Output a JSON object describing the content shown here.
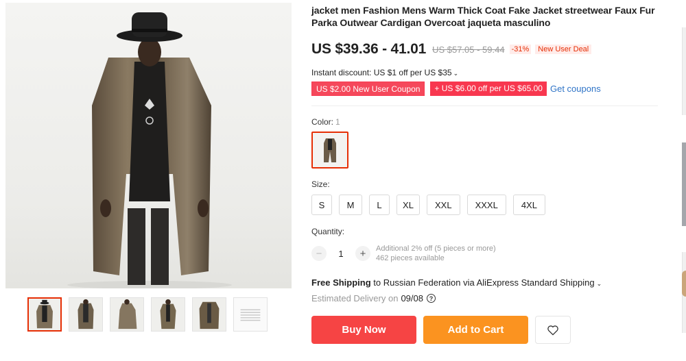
{
  "gallery": {
    "main_image": "fur-coat-model-photo",
    "thumbnails": [
      {
        "name": "thumb-1",
        "active": true
      },
      {
        "name": "thumb-2",
        "active": false
      },
      {
        "name": "thumb-3",
        "active": false
      },
      {
        "name": "thumb-4",
        "active": false
      },
      {
        "name": "thumb-5",
        "active": false
      },
      {
        "name": "thumb-6",
        "active": false
      }
    ]
  },
  "product": {
    "title": "jacket men Fashion Mens Warm Thick Coat Fake Jacket streetwear Faux Fur Parka Outwear Cardigan Overcoat jaqueta masculino",
    "price": "US $39.36 - 41.01",
    "original_price": "US $57.05 - 59.44",
    "discount": "-31%",
    "deal_badge": "New User Deal",
    "instant_discount": "Instant discount: US $1 off per US $35",
    "coupons": [
      "US $2.00 New User Coupon",
      "+ US $6.00 off per US $65.00"
    ],
    "get_coupons": "Get coupons"
  },
  "options": {
    "color_label": "Color:",
    "color_count": "1",
    "size_label": "Size:",
    "sizes": [
      "S",
      "M",
      "L",
      "XL",
      "XXL",
      "XXXL",
      "4XL"
    ]
  },
  "quantity": {
    "label": "Quantity:",
    "value": "1",
    "note_line1": "Additional 2% off (5 pieces or more)",
    "note_line2": "462 pieces available"
  },
  "shipping": {
    "free": "Free Shipping",
    "rest": " to Russian Federation via AliExpress Standard Shipping",
    "delivery_label": "Estimated Delivery on",
    "delivery_date": "09/08"
  },
  "actions": {
    "buy_now": "Buy Now",
    "add_to_cart": "Add to Cart"
  },
  "colors": {
    "accent": "#e62e04",
    "buy": "#f64444",
    "cart": "#fb9320",
    "coupon": "#f8374f",
    "link": "#2f74c7"
  }
}
